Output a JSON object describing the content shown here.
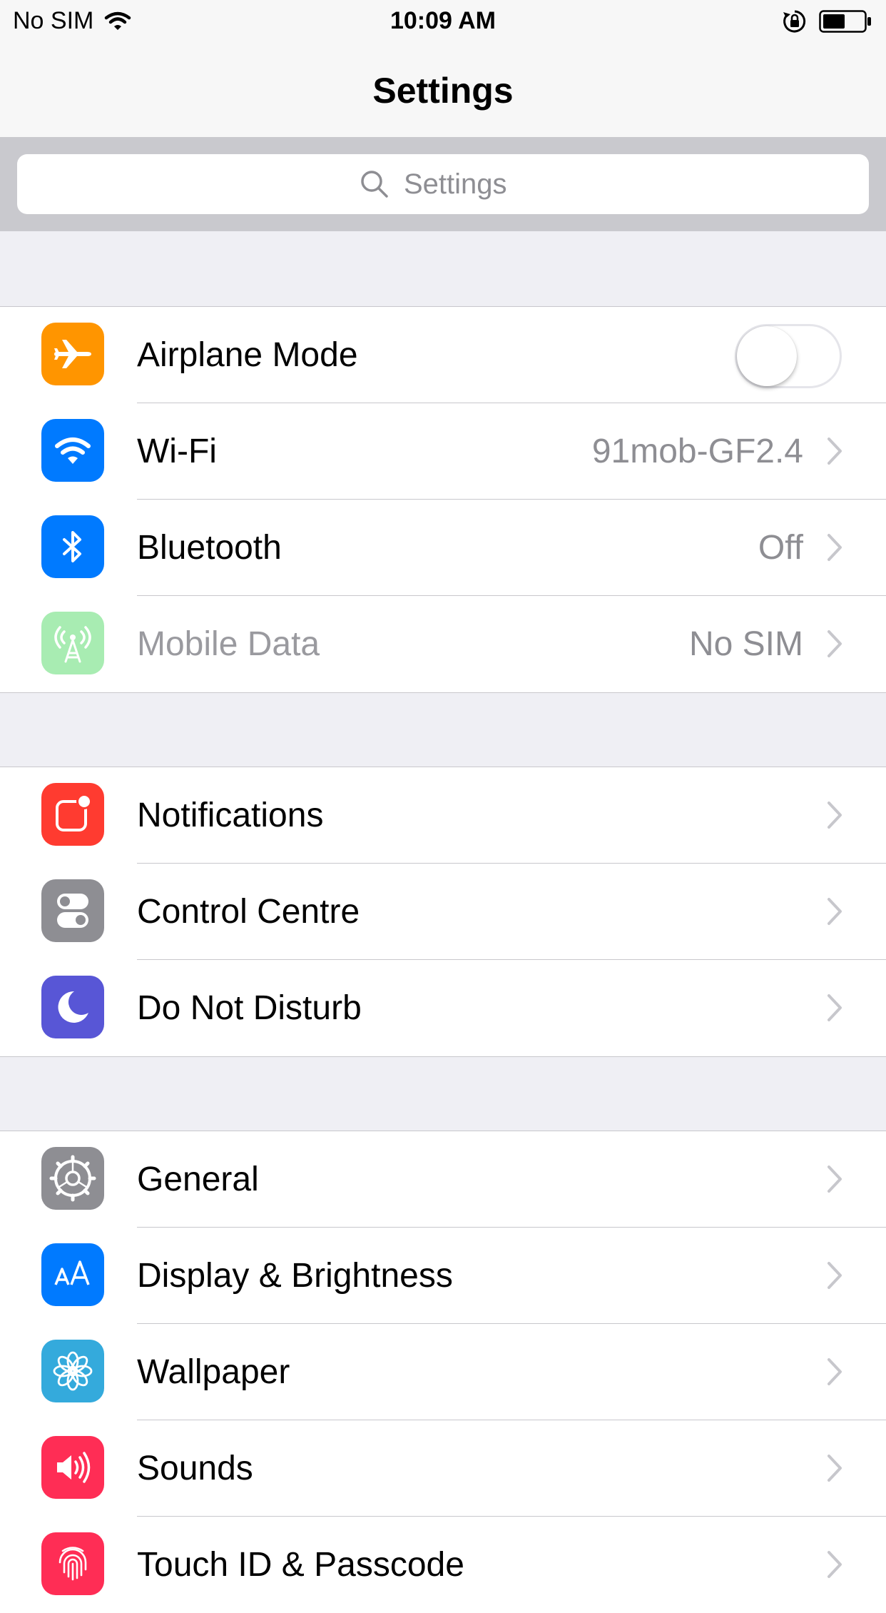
{
  "status_bar": {
    "carrier": "No SIM",
    "time": "10:09 AM"
  },
  "nav": {
    "title": "Settings"
  },
  "search": {
    "placeholder": "Settings"
  },
  "groups": [
    [
      {
        "name": "airplane",
        "label": "Airplane Mode",
        "value": "",
        "icon": "airplane-icon",
        "color": "#ff9500",
        "toggle": "off"
      },
      {
        "name": "wifi",
        "label": "Wi-Fi",
        "value": "91mob-GF2.4",
        "icon": "wifi-icon",
        "color": "#007aff"
      },
      {
        "name": "bluetooth",
        "label": "Bluetooth",
        "value": "Off",
        "icon": "bluetooth-icon",
        "color": "#007aff"
      },
      {
        "name": "mobile-data",
        "label": "Mobile Data",
        "value": "No SIM",
        "icon": "antenna-icon",
        "color": "#a8ecb2",
        "dimmed": true
      }
    ],
    [
      {
        "name": "notifications",
        "label": "Notifications",
        "value": "",
        "icon": "notifications-icon",
        "color": "#ff3b30"
      },
      {
        "name": "control-centre",
        "label": "Control Centre",
        "value": "",
        "icon": "switches-icon",
        "color": "#8e8e93"
      },
      {
        "name": "do-not-disturb",
        "label": "Do Not Disturb",
        "value": "",
        "icon": "moon-icon",
        "color": "#5856d6"
      }
    ],
    [
      {
        "name": "general",
        "label": "General",
        "value": "",
        "icon": "gear-icon",
        "color": "#8e8e93"
      },
      {
        "name": "display-brightness",
        "label": "Display & Brightness",
        "value": "",
        "icon": "text-size-icon",
        "color": "#007aff"
      },
      {
        "name": "wallpaper",
        "label": "Wallpaper",
        "value": "",
        "icon": "flower-icon",
        "color": "#34aadc"
      },
      {
        "name": "sounds",
        "label": "Sounds",
        "value": "",
        "icon": "speaker-icon",
        "color": "#ff2d55"
      },
      {
        "name": "touch-id",
        "label": "Touch ID & Passcode",
        "value": "",
        "icon": "fingerprint-icon",
        "color": "#ff2d55"
      }
    ]
  ]
}
